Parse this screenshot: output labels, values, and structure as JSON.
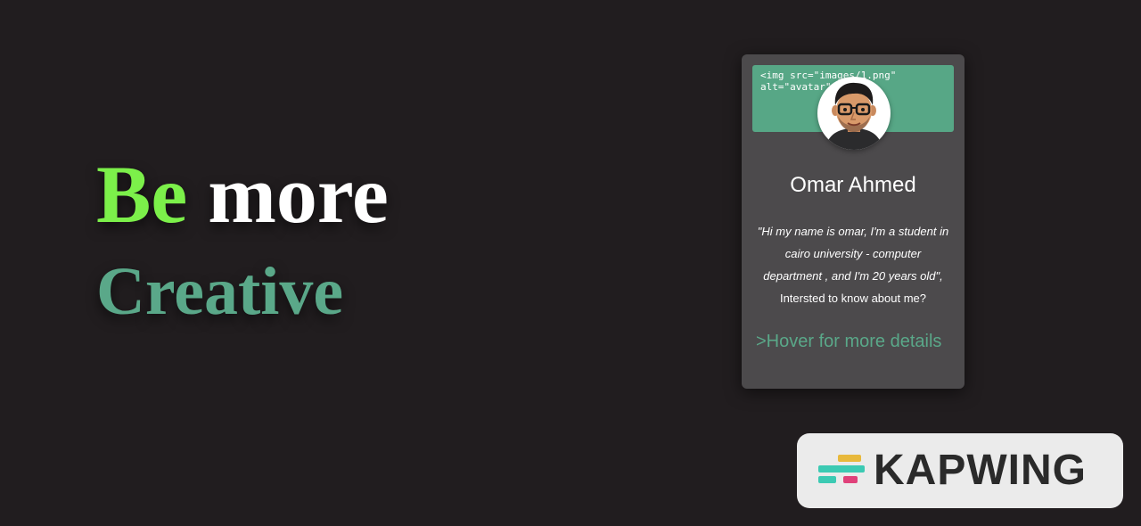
{
  "hero": {
    "word_be": "Be",
    "word_more": " more",
    "word_creative": "Creative"
  },
  "card": {
    "code_line1": "<img src=\"images/1.png\"",
    "code_line2": "alt=\"avatar\">",
    "name": "Omar Ahmed",
    "bio_quote": "\"Hi my name is omar, I'm a student in cairo university - computer department , and I'm 20 years old\",",
    "bio_question": " Intersted to know about me?",
    "hover_link": ">Hover for more details",
    "avatar_icon": "avatar-icon"
  },
  "watermark": {
    "text": "KAPWING",
    "logo_icon": "kapwing-logo-icon"
  },
  "colors": {
    "background": "#211d1f",
    "accent_green": "#7cf04a",
    "teal": "#5aa889",
    "card_bg": "#4c4a4c",
    "banner": "#57a786"
  }
}
